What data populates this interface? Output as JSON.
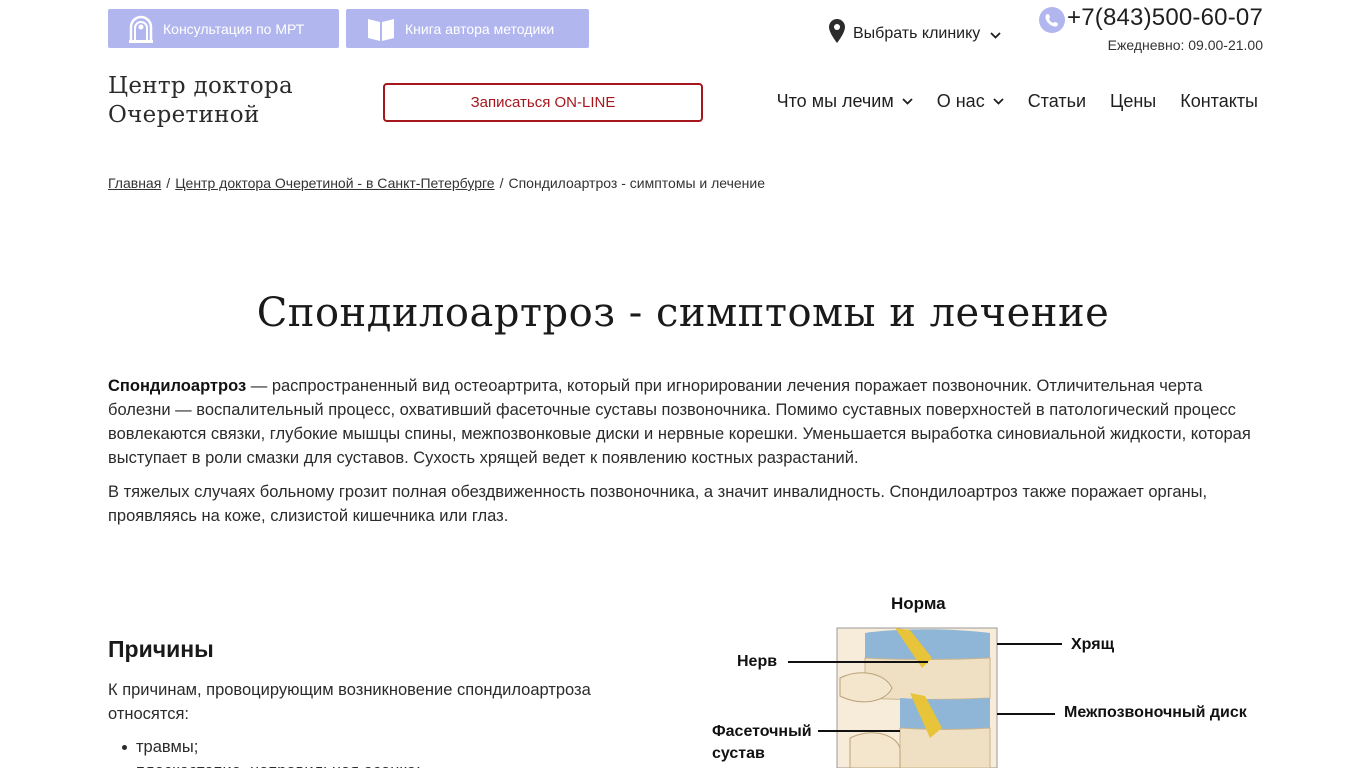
{
  "topbar": {
    "mrt_button": "Консультация по МРТ",
    "book_button": "Книга автора методики",
    "clinic_select": "Выбрать клинику",
    "phone": "+7(843)500-60-07",
    "hours": "Ежедневно: 09.00-21.00"
  },
  "header": {
    "logo_line1": "Центр доктора",
    "logo_line2": "Очеретиной",
    "signup_button": "Записаться ON-LINE",
    "nav": {
      "what_we_treat": "Что мы лечим",
      "about": "О нас",
      "articles": "Статьи",
      "prices": "Цены",
      "contacts": "Контакты"
    }
  },
  "breadcrumb": {
    "home": "Главная",
    "center": "Центр доктора Очеретиной - в Санкт-Петербурге",
    "current": "Спондилоартроз - симптомы и лечение",
    "separator": "/"
  },
  "article": {
    "title": "Спондилоартроз - симптомы и лечение",
    "para1_bold": "Спондилоартроз",
    "para1_rest": " — распространенный вид остеоартрита, который при игнорировании лечения поражает позвоночник. Отличительная черта болезни — воспалительный процесс, охвативший фасеточные суставы позвоночника. Помимо суставных поверхностей в патологический процесс вовлекаются связки, глубокие мышцы спины, межпозвонковые диски и нервные корешки. Уменьшается выработка синовиальной жидкости, которая выступает в роли смазки для суставов. Сухость хрящей ведет к появлению костных разрастаний.",
    "para2": "В тяжелых случаях больному грозит полная обездвиженность позвоночника, а значит инвалидность. Спондилоартроз также поражает органы, проявляясь на коже, слизистой кишечника или глаз.",
    "causes_heading": "Причины",
    "causes_intro": "К причинам, провоцирующим возникновение спондилоартроза относятся:",
    "causes": [
      "травмы;",
      "плоскостопие, неправильная осанка;"
    ]
  },
  "diagram": {
    "title": "Норма",
    "labels": {
      "nerve": "Нерв",
      "cartilage": "Хрящ",
      "facet_line1": "Фасеточный",
      "facet_line2": "сустав",
      "disc": "Межпозвоночный диск"
    }
  },
  "colors": {
    "accent_lavender": "#b1b6ef",
    "signup_red": "#a6171d"
  },
  "icons": {
    "mrt": "mri-scanner-icon",
    "book": "open-book-icon",
    "pin": "map-pin-icon",
    "phone": "phone-icon",
    "chevron": "chevron-down-icon"
  }
}
